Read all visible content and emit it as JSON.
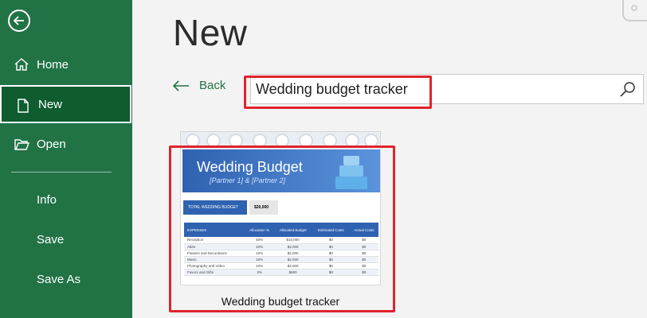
{
  "sidebar": {
    "back_icon": "back-arrow-icon",
    "items": [
      {
        "label": "Home",
        "icon": "home-icon"
      },
      {
        "label": "New",
        "icon": "new-document-icon"
      },
      {
        "label": "Open",
        "icon": "folder-open-icon"
      },
      {
        "label": "Info"
      },
      {
        "label": "Save"
      },
      {
        "label": "Save As"
      }
    ],
    "selected": "New"
  },
  "main": {
    "title": "New",
    "back_label": "Back",
    "search": {
      "value": "Wedding budget tracker",
      "icon": "search-icon"
    }
  },
  "template": {
    "name": "Wedding budget tracker",
    "thumbnail": {
      "title": "Wedding Budget",
      "subtitle": "[Partner 1] & [Partner 2]",
      "total_label": "TOTAL WEDDING BUDGET",
      "total_value": "$20,000",
      "columns": [
        "EXPENSES",
        "Allocation %",
        "Allocated Budget",
        "Estimated Costs",
        "Actual Costs"
      ],
      "rows": [
        [
          "Reception",
          "50%",
          "$10,000",
          "$0",
          "$0"
        ],
        [
          "Attire",
          "10%",
          "$2,000",
          "$0",
          "$0"
        ],
        [
          "Flowers and Decorations",
          "10%",
          "$2,000",
          "$0",
          "$0"
        ],
        [
          "Music",
          "10%",
          "$2,000",
          "$0",
          "$0"
        ],
        [
          "Photography and Video",
          "10%",
          "$2,000",
          "$0",
          "$0"
        ],
        [
          "Favors and Gifts",
          "3%",
          "$600",
          "$0",
          "$0"
        ]
      ]
    }
  },
  "colors": {
    "accent": "#217346",
    "selected": "#0e5c2f",
    "highlight": "#e0242b",
    "banner": "#2f62b0"
  }
}
